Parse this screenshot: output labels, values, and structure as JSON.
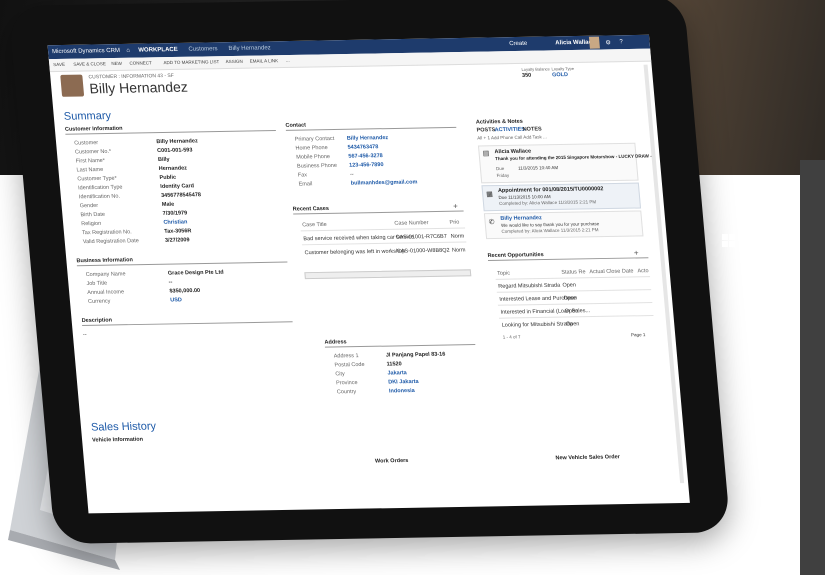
{
  "nav": {
    "app_title": "Microsoft Dynamics CRM",
    "workplace": "WORKPLACE",
    "breadcrumb_1": "Customers",
    "breadcrumb_2": "Billy Hernandez",
    "create": "Create",
    "user_name": "Alicia Wallace",
    "user_sub": "DAT"
  },
  "toolbar": {
    "save": "SAVE",
    "save_close": "SAVE & CLOSE",
    "new": "NEW",
    "connect": "CONNECT",
    "add_marketing": "ADD TO MARKETING LIST",
    "assign": "ASSIGN",
    "email_link": "EMAIL A LINK",
    "more": "..."
  },
  "header": {
    "breadcrumb": "CUSTOMER : INFORMATION 43 - SF",
    "name": "Billy Hernandez",
    "loyalty_label": "Loyalty Balance",
    "loyalty_value": "350",
    "loyalty_type_label": "Loyalty Type",
    "loyalty_type_value": "GOLD"
  },
  "summary": {
    "title": "Summary",
    "customer_info": "Customer Information",
    "fields": [
      {
        "label": "Customer",
        "value": "Billy Hernandez"
      },
      {
        "label": "Customer No.*",
        "value": "C001-001-593"
      },
      {
        "label": "First Name*",
        "value": "Billy"
      },
      {
        "label": "Last Name",
        "value": "Hernandez"
      },
      {
        "label": "Customer Type*",
        "value": "Public"
      },
      {
        "label": "Identification Type",
        "value": "Identity Card"
      },
      {
        "label": "Identification No.",
        "value": "3456778545478"
      },
      {
        "label": "Gender",
        "value": "Male"
      },
      {
        "label": "Birth Date",
        "value": "7/30/1979"
      },
      {
        "label": "Religion",
        "value": "Christian"
      },
      {
        "label": "Tax Registration No.",
        "value": "Tax-3056R"
      },
      {
        "label": "Valid Registration Date",
        "value": "3/27/2009"
      }
    ],
    "business_info": "Business Information",
    "business_fields": [
      {
        "label": "Company Name",
        "value": "Grace Design Pte Ltd"
      },
      {
        "label": "Job Title",
        "value": "--"
      },
      {
        "label": "Annual Income",
        "value": "$350,000.00"
      },
      {
        "label": "Currency",
        "value": "USD"
      }
    ],
    "description": "Description",
    "description_value": "--",
    "sales_history": "Sales History",
    "vehicle_info": "Vehicle Information"
  },
  "contact": {
    "title": "Contact",
    "fields": [
      {
        "label": "Primary Contact",
        "value": "Billy Hernandez"
      },
      {
        "label": "Home Phone",
        "value": "5434763478"
      },
      {
        "label": "Mobile Phone",
        "value": "567-456-3278"
      },
      {
        "label": "Business Phone",
        "value": "123-456-7890"
      },
      {
        "label": "Fax",
        "value": "--"
      },
      {
        "label": "Email",
        "value": "bullmanhdes@gmail.com"
      }
    ]
  },
  "recent_cases": {
    "title": "Recent Cases",
    "columns": [
      "Case Title",
      "Case Number",
      "Prio"
    ],
    "rows": [
      {
        "title": "Bad service received when taking car service",
        "number": "CAS-01001-R7C6B7",
        "priority": "Norm"
      },
      {
        "title": "Customer belonging was left in workshop",
        "number": "CAS-01000-W8B8Q2",
        "priority": "Norm"
      }
    ]
  },
  "address": {
    "title": "Address",
    "fields": [
      {
        "label": "Address 1",
        "value": "Jl Panjang Papel 83-16"
      },
      {
        "label": "Postal Code",
        "value": "11520"
      },
      {
        "label": "City",
        "value": "Jakarta"
      },
      {
        "label": "Province",
        "value": "DKI Jakarta"
      },
      {
        "label": "Country",
        "value": "Indonesia"
      }
    ]
  },
  "activities": {
    "title": "Activities & Notes",
    "tabs": [
      "POSTS",
      "ACTIVITIES",
      "NOTES"
    ],
    "filter": "All  +  1 Add Phone Call    Add Task    ...",
    "items": [
      {
        "name": "Alicia Wallace",
        "text": "Thank you for attending the 2015 Singapore Motorshow - LUCKY DRAW -",
        "due": "Due",
        "date": "11/3/2015 10:40 AM",
        "sub": "Friday"
      },
      {
        "name": "Appointment for 001/08/2015/TU0000002",
        "text": "Due   11/13/2015 10:00 AM",
        "due": "",
        "date": "Completed by: Alicia Wallace  11/3/2015 2:21 PM",
        "sub": ""
      },
      {
        "name": "Billy Hernandez",
        "text": "We would like to say thank you for your purchase",
        "due": "",
        "date": "Completed by: Alicia Wallace  11/3/2015 2:21 PM",
        "sub": ""
      }
    ]
  },
  "opportunities": {
    "title": "Recent Opportunities",
    "columns": [
      "Topic",
      "Status Re",
      "Actual Close Date",
      "Acto"
    ],
    "rows": [
      {
        "topic": "Regard Mitsubishi Strada",
        "status": "Open"
      },
      {
        "topic": "Interested Lease and Purchase",
        "status": "Open"
      },
      {
        "topic": "Interested in Financial (Loan Sales...",
        "status": "Open"
      },
      {
        "topic": "Looking for Mitsubishi Strada",
        "status": "Open"
      }
    ],
    "footer": "1 - 4 of 7",
    "pager": "Page 1"
  },
  "bottom": {
    "work_orders": "Work Orders",
    "new_vehicle": "New Vehicle Sales Order"
  },
  "colors": {
    "nav": "#1e3b6c",
    "link": "#1e5aa8",
    "accent": "#f2b100"
  }
}
